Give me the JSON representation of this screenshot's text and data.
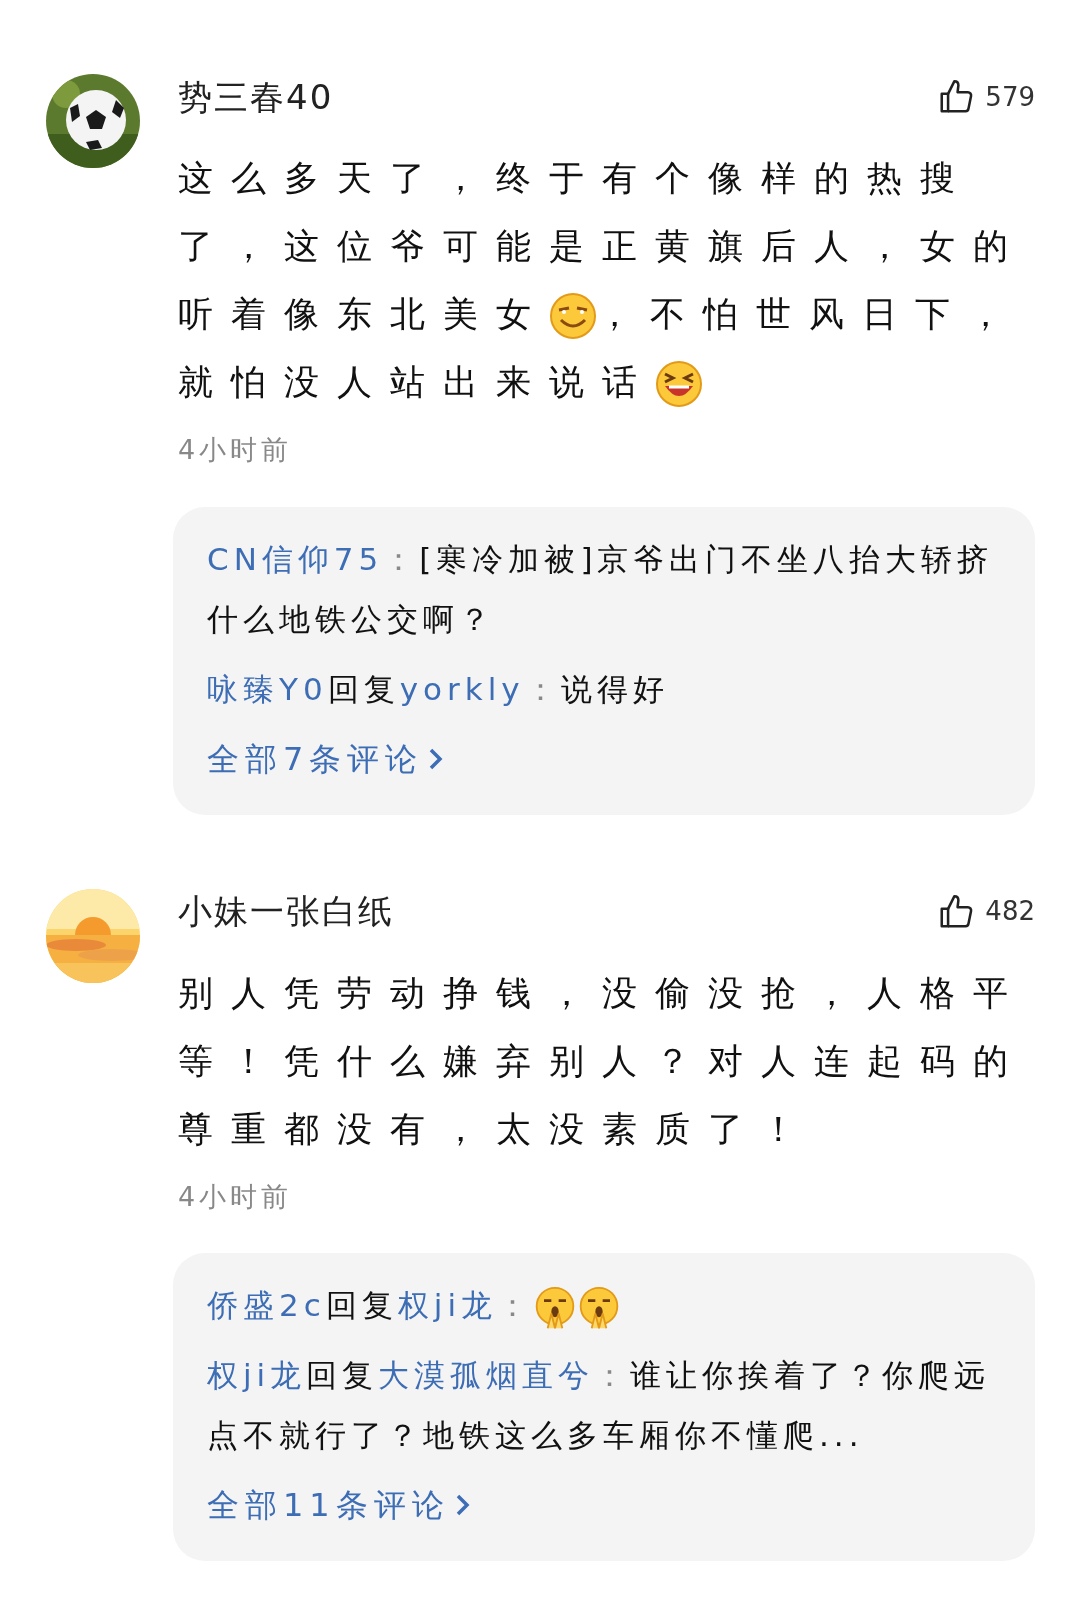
{
  "comments": [
    {
      "username": "势三春40",
      "likes": "579",
      "body": [
        {
          "kind": "text",
          "text": "这么多天了，终于有个像样的热搜了，这位爷可能是正黄旗后人，女的听着像东北美女"
        },
        {
          "kind": "smirk"
        },
        {
          "kind": "text",
          "text": "，不怕世风日下，就怕没人站出来说话"
        },
        {
          "kind": "laugh"
        }
      ],
      "time": "4小时前",
      "replies": [
        [
          {
            "kind": "name",
            "text": "CN信仰75"
          },
          {
            "kind": "sep",
            "text": "："
          },
          {
            "kind": "text",
            "text": "[寒冷加被]京爷出门不坐八抬大轿挤什么地铁公交啊？"
          }
        ],
        [
          {
            "kind": "name",
            "text": "咏臻Y0"
          },
          {
            "kind": "text",
            "text": "回复"
          },
          {
            "kind": "name",
            "text": "yorkly"
          },
          {
            "kind": "sep",
            "text": "："
          },
          {
            "kind": "text",
            "text": "说得好"
          }
        ]
      ],
      "more": "全部7条评论"
    },
    {
      "username": "小妹一张白纸",
      "likes": "482",
      "body": [
        {
          "kind": "text",
          "text": "别人凭劳动挣钱，没偷没抢，人格平等！凭什么嫌弃别人？对人连起码的尊重都没有，太没素质了！"
        }
      ],
      "time": "4小时前",
      "replies": [
        [
          {
            "kind": "name",
            "text": "侨盛2c"
          },
          {
            "kind": "text",
            "text": "回复"
          },
          {
            "kind": "name",
            "text": "权ji龙"
          },
          {
            "kind": "sep",
            "text": "："
          },
          {
            "kind": "pray"
          },
          {
            "kind": "pray"
          }
        ],
        [
          {
            "kind": "name",
            "text": "权ji龙"
          },
          {
            "kind": "text",
            "text": "回复"
          },
          {
            "kind": "name",
            "text": "大漠孤烟直兮"
          },
          {
            "kind": "sep",
            "text": "："
          },
          {
            "kind": "text",
            "text": "谁让你挨着了？你爬远点不就行了？地铁这么多车厢你不懂爬..."
          }
        ]
      ],
      "more": "全部11条评论"
    }
  ]
}
